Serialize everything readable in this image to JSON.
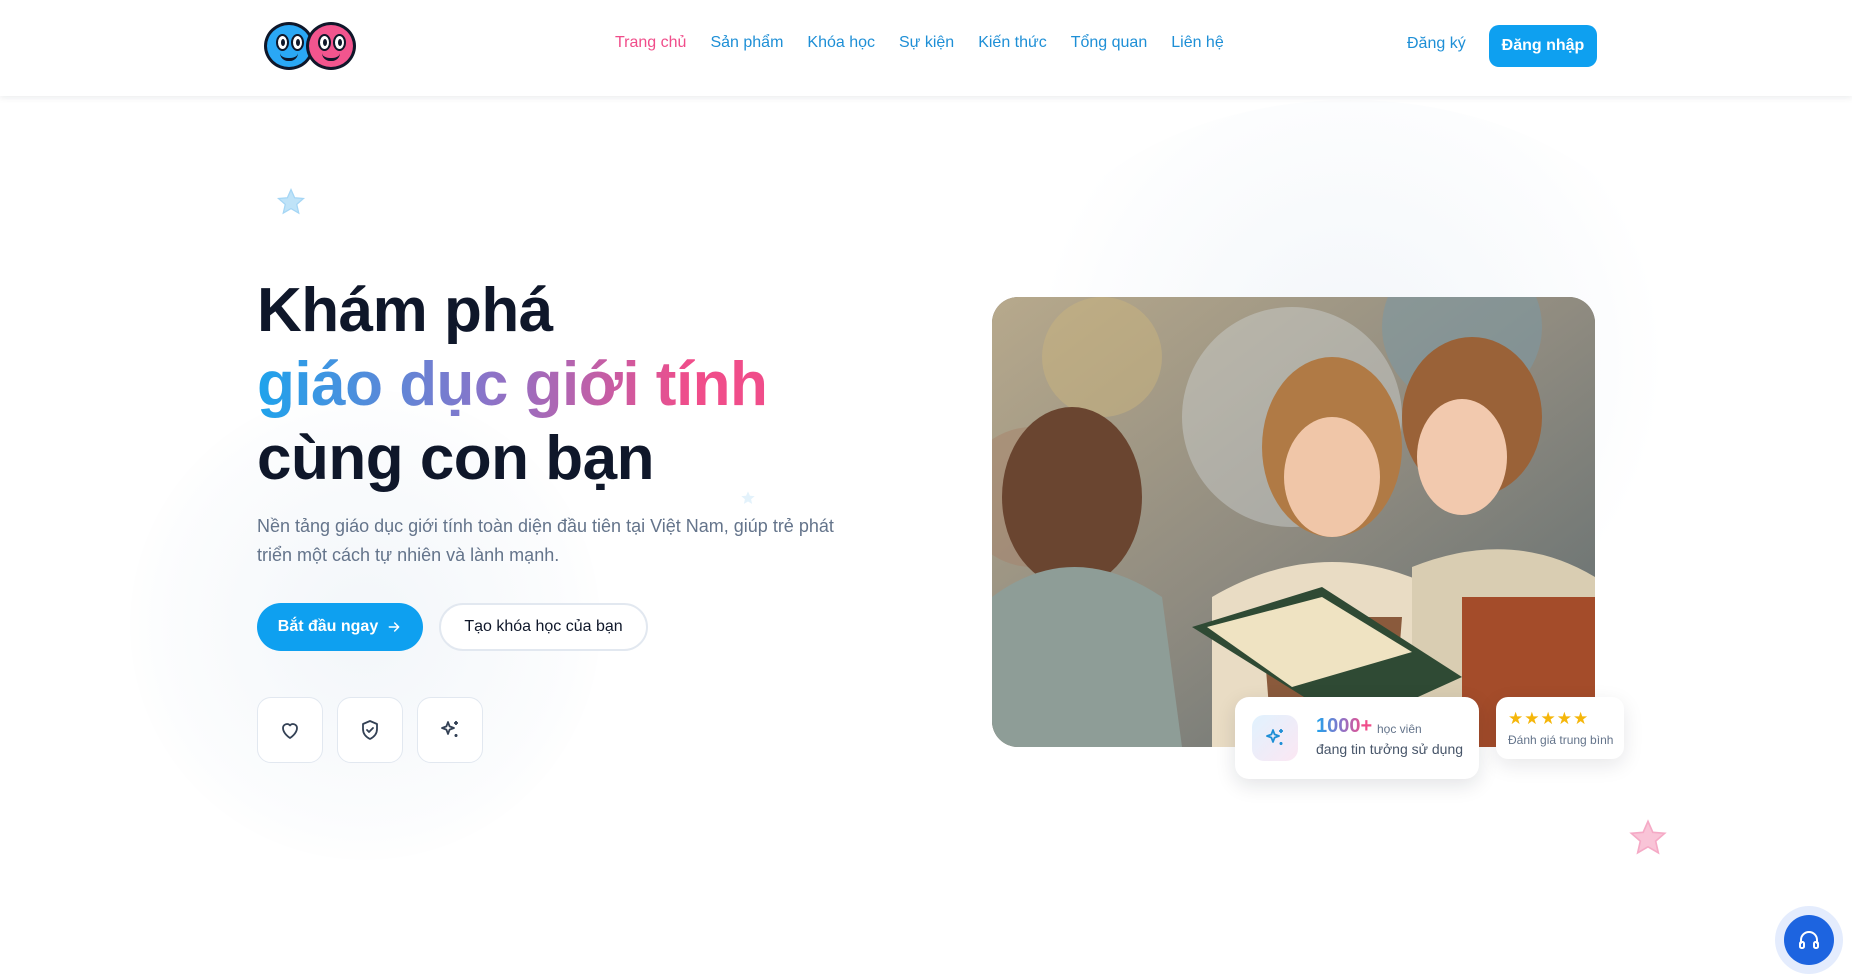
{
  "header": {
    "logo_alt": "logo",
    "nav": [
      {
        "label": "Trang chủ",
        "active": true
      },
      {
        "label": "Sản phẩm",
        "active": false
      },
      {
        "label": "Khóa học",
        "active": false
      },
      {
        "label": "Sự kiện",
        "active": false
      },
      {
        "label": "Kiến thức",
        "active": false
      },
      {
        "label": "Tổng quan",
        "active": false
      },
      {
        "label": "Liên hệ",
        "active": false
      }
    ],
    "signup_label": "Đăng ký",
    "login_label": "Đăng nhập"
  },
  "hero": {
    "title_line1": "Khám phá",
    "title_line2_words": [
      "giáo",
      "dục",
      "giới",
      "tính"
    ],
    "title_line3": "cùng con bạn",
    "subtitle": "Nền tảng giáo dục giới tính toàn diện đầu tiên tại Việt Nam, giúp trẻ phát triển một cách tự nhiên và lành mạnh.",
    "primary_button": "Bắt đầu ngay",
    "secondary_button": "Tạo khóa học của bạn",
    "feature_icons": [
      "heart-icon",
      "shield-check-icon",
      "sparkles-icon"
    ]
  },
  "stats": {
    "number": "1000+",
    "unit": "học viên",
    "description": "đang tin tưởng sử dụng",
    "icon": "sparkles-icon"
  },
  "rating": {
    "stars": 5,
    "label": "Đánh giá trung bình"
  },
  "support": {
    "icon": "headphones-icon"
  },
  "colors": {
    "primary": "#0ea0f0",
    "accent_pink": "#f04d8a",
    "nav_link": "#1e8fd6",
    "heading": "#0f172a",
    "muted": "#64748b",
    "star_yellow": "#f5b60a"
  }
}
